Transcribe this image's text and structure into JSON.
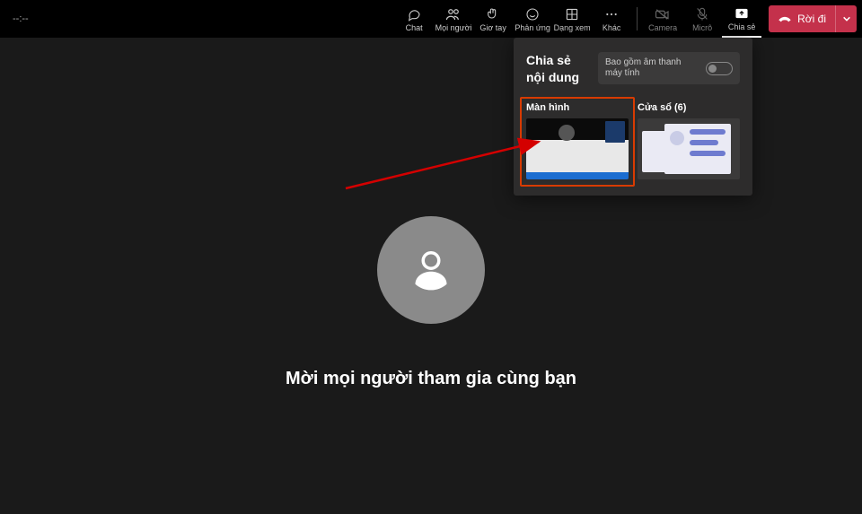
{
  "topbar": {
    "timer": "--:--",
    "buttons": {
      "chat": "Chat",
      "people": "Mọi người",
      "raise_hand": "Giơ tay",
      "reactions": "Phản ứng",
      "view": "Dạng xem",
      "more": "Khác",
      "camera": "Camera",
      "mic": "Micrô",
      "share": "Chia sẻ"
    },
    "leave": {
      "label": "Rời đi"
    }
  },
  "main": {
    "invite_text": "Mời mọi người tham gia cùng bạn"
  },
  "share_panel": {
    "title": "Chia sẻ nội dung",
    "include_audio": "Bao gồm âm thanh máy tính",
    "options": {
      "screen": "Màn hình",
      "window": "Cửa sổ (6)"
    }
  }
}
